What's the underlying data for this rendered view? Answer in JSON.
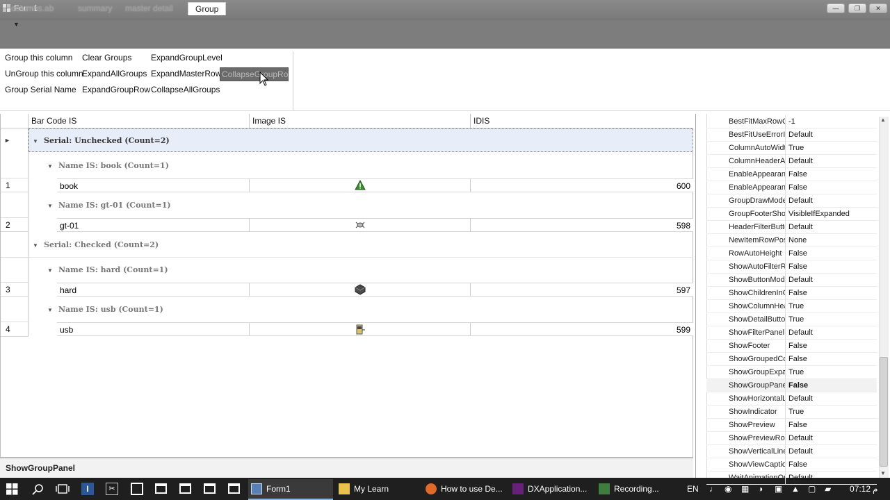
{
  "window": {
    "title": "Form1"
  },
  "ribbon": {
    "tabs": [
      {
        "label": "columns.ab"
      },
      {
        "label": "summary"
      },
      {
        "label": "master detail"
      },
      {
        "label": "Group"
      }
    ],
    "buttons": {
      "group_this_column": "Group this column",
      "ungroup_this_column": "UnGroup this column",
      "group_serial_name": "Group Serial  Name",
      "clear_groups": "Clear Groups",
      "expand_all_groups": "ExpandAllGroups",
      "expand_group_row": "ExpandGroupRow",
      "expand_group_level": "ExpandGroupLevel",
      "expand_master_row": "ExpandMasterRow",
      "collapse_all_groups": "CollapseAllGroups",
      "collapse_group_row": "CollapseGroupRow"
    }
  },
  "grid": {
    "columns": [
      "Bar Code IS",
      "Image IS",
      "IDIS"
    ],
    "groups": [
      {
        "label": "Serial: Unchecked (Count=2)"
      },
      {
        "label": "Name IS: book (Count=1)"
      },
      {
        "label": "Name IS: gt-01 (Count=1)"
      },
      {
        "label": "Serial: Checked (Count=2)"
      },
      {
        "label": "Name IS: hard (Count=1)"
      },
      {
        "label": "Name IS: usb (Count=1)"
      }
    ],
    "rows": [
      {
        "index": "1",
        "barcode": "book",
        "image": "warning-icon",
        "id": "600"
      },
      {
        "index": "2",
        "barcode": "gt-01",
        "image": "bug-icon",
        "id": "598"
      },
      {
        "index": "3",
        "barcode": "hard",
        "image": "hard-drive-icon",
        "id": "597"
      },
      {
        "index": "4",
        "barcode": "usb",
        "image": "usb-icon",
        "id": "599"
      }
    ]
  },
  "footer": {
    "label": "ShowGroupPanel"
  },
  "properties": [
    {
      "name": "BestFitMaxRowC",
      "value": "-1"
    },
    {
      "name": "BestFitUseErrorIr",
      "value": "Default"
    },
    {
      "name": "ColumnAutoWidt",
      "value": "True"
    },
    {
      "name": "ColumnHeaderAu",
      "value": "Default"
    },
    {
      "name": "EnableAppearanc",
      "value": "False"
    },
    {
      "name": "EnableAppearanc",
      "value": "False"
    },
    {
      "name": "GroupDrawMode",
      "value": "Default"
    },
    {
      "name": "GroupFooterShov",
      "value": "VisibleIfExpanded"
    },
    {
      "name": "HeaderFilterButto",
      "value": "Default"
    },
    {
      "name": "NewItemRowPos",
      "value": "None"
    },
    {
      "name": "RowAutoHeight",
      "value": "False"
    },
    {
      "name": "ShowAutoFilterR",
      "value": "False"
    },
    {
      "name": "ShowButtonMode",
      "value": "Default"
    },
    {
      "name": "ShowChildrenInG",
      "value": "False"
    },
    {
      "name": "ShowColumnHea",
      "value": "True"
    },
    {
      "name": "ShowDetailButto",
      "value": "True"
    },
    {
      "name": "ShowFilterPanelN",
      "value": "Default"
    },
    {
      "name": "ShowFooter",
      "value": "False"
    },
    {
      "name": "ShowGroupedCo",
      "value": "False"
    },
    {
      "name": "ShowGroupExpar",
      "value": "True"
    },
    {
      "name": "ShowGroupPanel",
      "value": "False"
    },
    {
      "name": "ShowHorizontalLi",
      "value": "Default"
    },
    {
      "name": "ShowIndicator",
      "value": "True"
    },
    {
      "name": "ShowPreview",
      "value": "False"
    },
    {
      "name": "ShowPreviewRov",
      "value": "Default"
    },
    {
      "name": "ShowVerticalLine",
      "value": "Default"
    },
    {
      "name": "ShowViewCaptio",
      "value": "False"
    },
    {
      "name": "WaitAnimationOp",
      "value": "Default"
    }
  ],
  "taskbar": {
    "apps": [
      {
        "label": "Form1"
      },
      {
        "label": "My Learn"
      },
      {
        "label": "How to use De..."
      },
      {
        "label": "DXApplication..."
      },
      {
        "label": "Recording..."
      }
    ],
    "language": "EN",
    "clock": "07:12",
    "ampm": "م"
  },
  "colors": {
    "accent": "#3a3a3a",
    "group_highlight": "#e8eef9",
    "titlebar": "#808080"
  }
}
